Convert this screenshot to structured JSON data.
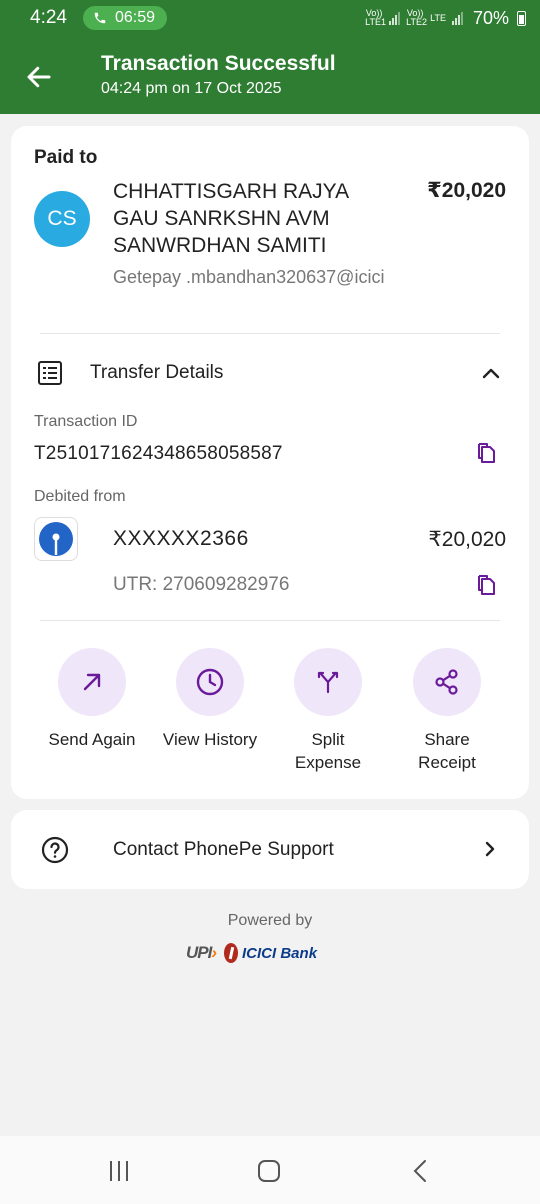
{
  "status_bar": {
    "time": "4:24",
    "call_timer": "06:59",
    "sim1": "Vo)) LTE1",
    "sim2": "Vo)) LTE2",
    "network": "LTE",
    "battery": "70%"
  },
  "header": {
    "title": "Transaction Successful",
    "subtitle": "04:24 pm on 17 Oct 2025",
    "bg_color": "#2e7d32"
  },
  "payee": {
    "section_label": "Paid to",
    "avatar_initials": "CS",
    "name": "CHHATTISGARH RAJYA GAU SANRKSHN AVM SANWRDHAN SAMITI",
    "amount": "₹20,020",
    "upi_id": "Getepay .mbandhan320637@icici"
  },
  "transfer_details": {
    "label": "Transfer Details",
    "transaction_id_label": "Transaction ID",
    "transaction_id": "T2510171624348658058587",
    "debited_from_label": "Debited from",
    "account": "XXXXXX2366",
    "account_amount": "₹20,020",
    "utr": "UTR: 270609282976"
  },
  "actions": [
    {
      "label": "Send Again",
      "icon": "arrow-up-right-icon"
    },
    {
      "label": "View History",
      "icon": "clock-icon"
    },
    {
      "label": "Split Expense",
      "icon": "split-icon"
    },
    {
      "label": "Share Receipt",
      "icon": "share-icon"
    }
  ],
  "support": {
    "label": "Contact PhonePe Support"
  },
  "footer": {
    "powered_by": "Powered by",
    "upi_logo": "UPI",
    "bank_logo": "ICICI Bank"
  },
  "colors": {
    "accent_purple": "#6a1b9a",
    "action_bg": "#f0e6fa",
    "avatar": "#29aae1"
  }
}
